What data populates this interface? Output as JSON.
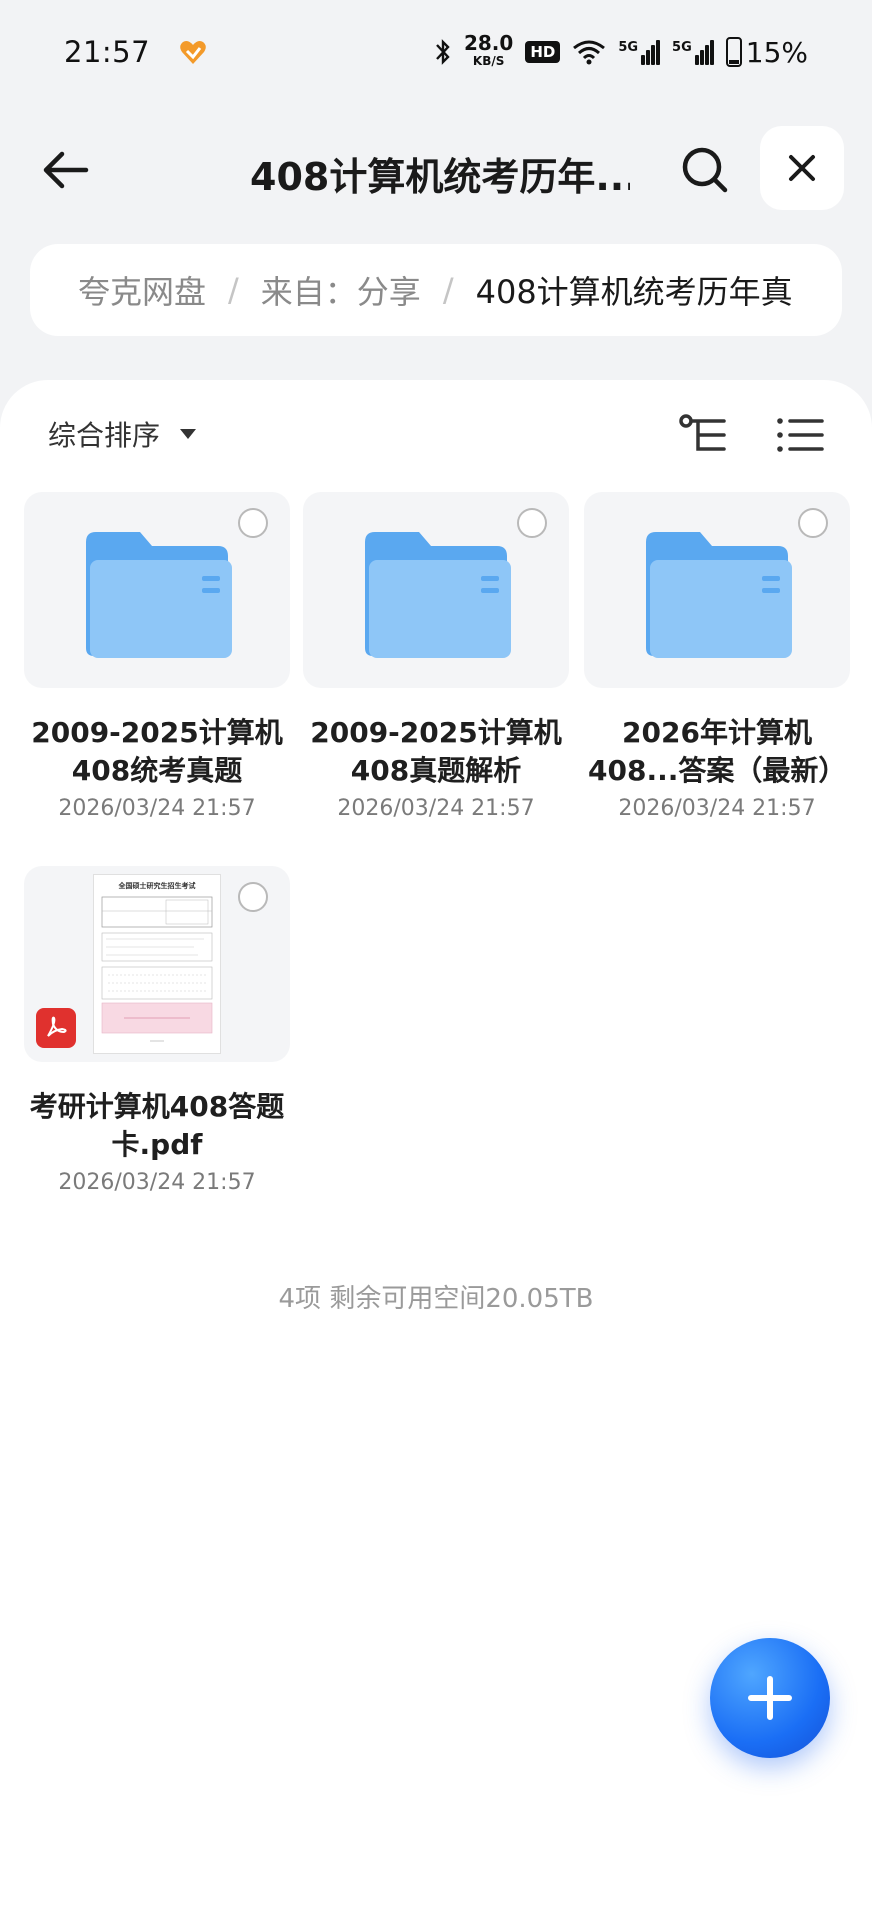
{
  "status_bar": {
    "time": "21:57",
    "net_speed": "28.0",
    "net_unit": "KB/S",
    "hd": "HD",
    "sim1": "5G",
    "sim2": "5G",
    "battery": "15%"
  },
  "header": {
    "title": "408计算机统考历年..."
  },
  "breadcrumb": {
    "items": [
      "夸克网盘",
      "来自：分享",
      "408计算机统考历年真"
    ]
  },
  "toolbar": {
    "sort_label": "综合排序"
  },
  "files": [
    {
      "name": "2009-2025计算机408统考真题",
      "date": "2026/03/24 21:57",
      "type": "folder"
    },
    {
      "name": "2009-2025计算机408真题解析",
      "date": "2026/03/24 21:57",
      "type": "folder"
    },
    {
      "name": "2026年计算机408...答案（最新）",
      "date": "2026/03/24 21:57",
      "type": "folder"
    },
    {
      "name": "考研计算机408答题卡.pdf",
      "date": "2026/03/24 21:57",
      "type": "pdf"
    }
  ],
  "pdf_preview_title": "全国硕士研究生招生考试",
  "footer": {
    "info": "4项 剩余可用空间20.05TB"
  },
  "colors": {
    "accent": "#1a6ef5",
    "folder": "#5aa8f0",
    "pdf": "#e0312e"
  }
}
